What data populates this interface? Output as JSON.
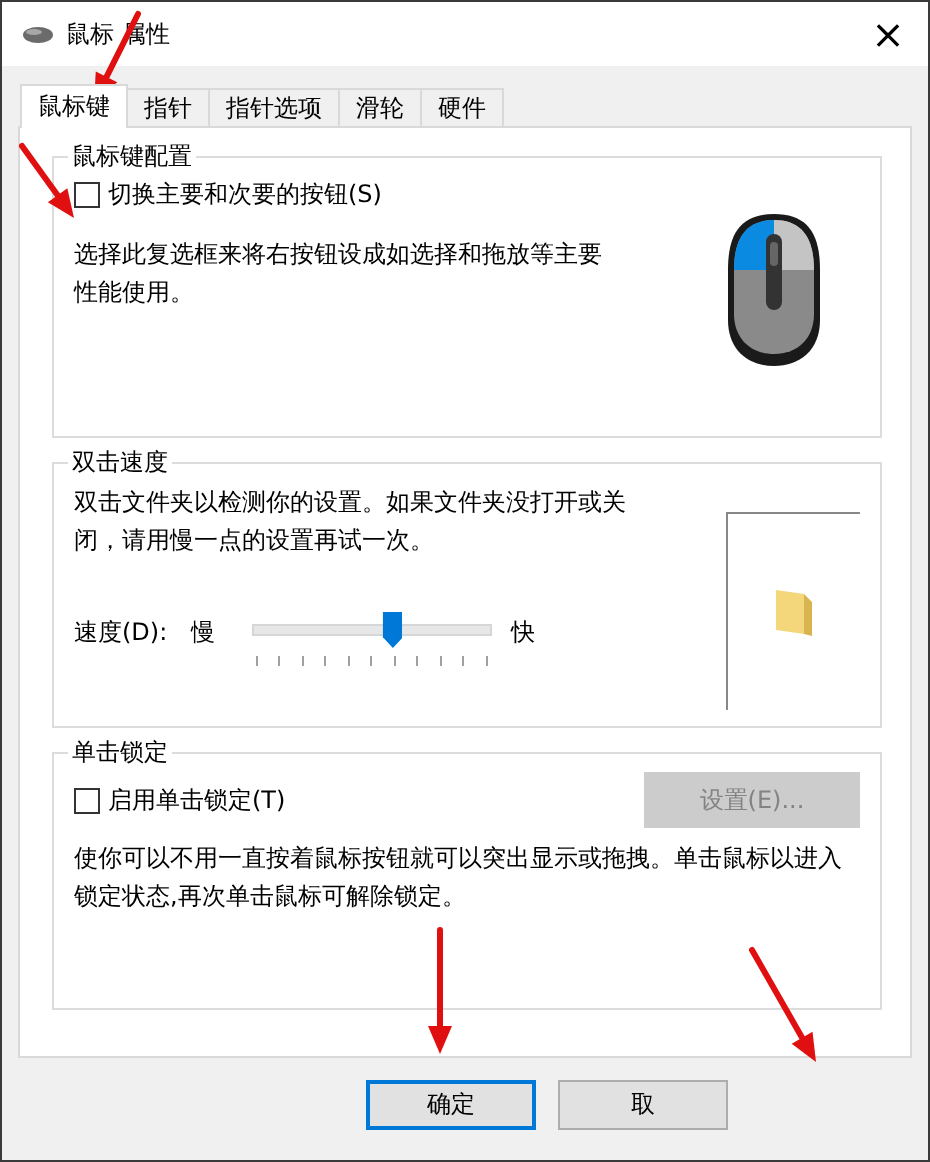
{
  "window": {
    "title": "鼠标 属性",
    "close": "×"
  },
  "tabs": [
    {
      "label": "鼠标键",
      "selected": true
    },
    {
      "label": "指针",
      "selected": false
    },
    {
      "label": "指针选项",
      "selected": false
    },
    {
      "label": "滑轮",
      "selected": false
    },
    {
      "label": "硬件",
      "selected": false
    }
  ],
  "button_config": {
    "title": "鼠标键配置",
    "checkbox": {
      "label": "切换主要和次要的按钮(S)",
      "checked": false
    },
    "description": "选择此复选框来将右按钮设成如选择和拖放等主要性能使用。"
  },
  "double_click": {
    "title": "双击速度",
    "description": "双击文件夹以检测你的设置。如果文件夹没打开或关闭，请用慢一点的设置再试一次。",
    "speed_label": "速度(D):",
    "slow": "慢",
    "fast": "快",
    "level": 0.59
  },
  "click_lock": {
    "title": "单击锁定",
    "checkbox": {
      "label": "启用单击锁定(T)",
      "checked": false
    },
    "settings_button": {
      "label": "设置(E)...",
      "disabled": true
    },
    "description": "使你可以不用一直按着鼠标按钮就可以突出显示或拖拽。单击鼠标以进入锁定状态,再次单击鼠标可解除锁定。"
  },
  "buttons": [
    {
      "label": "确定",
      "focused": true
    },
    {
      "label": "取",
      "focused": false
    }
  ]
}
